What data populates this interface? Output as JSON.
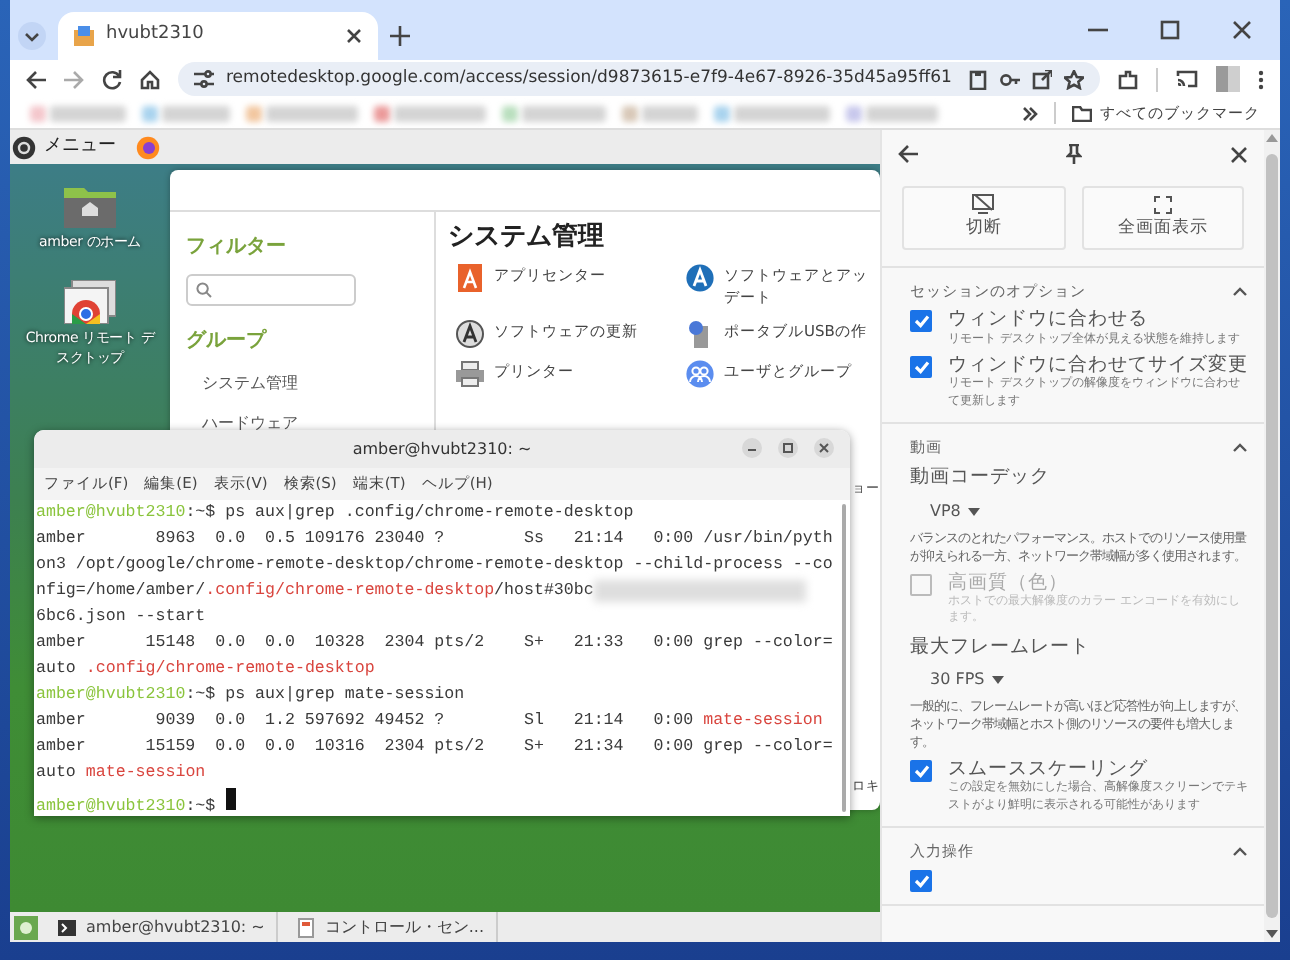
{
  "browser": {
    "tab": {
      "title": "hvubt2310",
      "selected": true
    },
    "address": "remotedesktop.google.com/access/session/d9873615-e7f9-4e67-8926-35d45a95ff61",
    "bookmarks_folder": "すべてのブックマーク"
  },
  "remote_desktop": {
    "top_panel": {
      "menu": "メニュー"
    },
    "desktop_icons": [
      {
        "kind": "folder",
        "label": "amber のホーム"
      },
      {
        "kind": "app",
        "label": "Chrome リモート デ",
        "label_2": "スクトップ"
      }
    ],
    "control_center": {
      "filter_heading": "フィルター",
      "groups_heading": "グループ",
      "groups": [
        "システム管理",
        "ハードウェア"
      ],
      "section_title": "システム管理",
      "items": [
        {
          "kind": "appcenter",
          "lines": [
            "アプリセンター"
          ]
        },
        {
          "kind": "software",
          "lines": [
            "ソフトウェアとアッ",
            "デート"
          ]
        },
        {
          "kind": "update",
          "lines": [
            "ソフトウェアの更新"
          ]
        },
        {
          "kind": "usb",
          "lines": [
            "ポータブルUSBの作"
          ]
        },
        {
          "kind": "printer",
          "lines": [
            "プリンター"
          ]
        },
        {
          "kind": "users",
          "lines": [
            "ユーザとグループ"
          ]
        }
      ],
      "edge_fragments": [
        "ョー",
        "ロキ"
      ]
    },
    "terminal": {
      "title": "amber@hvubt2310: ~",
      "menu": [
        "ファイル(F)",
        "編集(E)",
        "表示(V)",
        "検索(S)",
        "端末(T)",
        "ヘルプ(H)"
      ],
      "lines": [
        [
          {
            "kind": "prompt",
            "text": "amber@hvubt2310"
          },
          {
            "kind": "path",
            "text": ":~$ "
          },
          {
            "kind": "text",
            "text": "ps aux|grep .config/chrome-remote-desktop"
          }
        ],
        [
          {
            "kind": "text",
            "text": "amber       8963  0.0  0.5 109176 23040 ?        Ss   21:14   0:00 /usr/bin/pyth"
          }
        ],
        [
          {
            "kind": "text",
            "text": "on3 /opt/google/chrome-remote-desktop/chrome-remote-desktop --child-process --co"
          }
        ],
        [
          {
            "kind": "text",
            "text": "nfig=/home/amber/"
          },
          {
            "kind": "match",
            "text": ".config/chrome-remote-desktop"
          },
          {
            "kind": "text",
            "text": "/host#30bc"
          },
          {
            "kind": "redacted"
          }
        ],
        [
          {
            "kind": "text",
            "text": "6bc6.json --start"
          }
        ],
        [
          {
            "kind": "text",
            "text": "amber      15148  0.0  0.0  10328  2304 pts/2    S+   21:33   0:00 grep --color="
          }
        ],
        [
          {
            "kind": "text",
            "text": "auto "
          },
          {
            "kind": "match",
            "text": ".config/chrome-remote-desktop"
          }
        ],
        [
          {
            "kind": "prompt",
            "text": "amber@hvubt2310"
          },
          {
            "kind": "path",
            "text": ":~$ "
          },
          {
            "kind": "text",
            "text": "ps aux|grep mate-session"
          }
        ],
        [
          {
            "kind": "text",
            "text": "amber       9039  0.0  1.2 597692 49452 ?        Sl   21:14   0:00 "
          },
          {
            "kind": "match",
            "text": "mate-session"
          }
        ],
        [
          {
            "kind": "text",
            "text": "amber      15159  0.0  0.0  10316  2304 pts/2    S+   21:34   0:00 grep --color="
          }
        ],
        [
          {
            "kind": "text",
            "text": "auto "
          },
          {
            "kind": "match",
            "text": "mate-session"
          }
        ],
        [
          {
            "kind": "prompt",
            "text": "amber@hvubt2310"
          },
          {
            "kind": "path",
            "text": ":~$ "
          },
          {
            "kind": "cursor"
          }
        ]
      ]
    },
    "taskbar": [
      {
        "kind": "terminal",
        "label": "amber@hvubt2310: ~"
      },
      {
        "kind": "control",
        "label": "コントロール・セン..."
      }
    ]
  },
  "side_panel": {
    "buttons": [
      {
        "kind": "disconnect",
        "label": "切断"
      },
      {
        "kind": "fullscreen",
        "label": "全画面表示"
      }
    ],
    "sections": [
      {
        "title": "セッションのオプション",
        "expanded": true,
        "items": [
          {
            "kind": "checkbox",
            "label": "ウィンドウに合わせる",
            "description": "リモート デスクトップ全体が見える状態を維持します",
            "checked": true,
            "disabled": false
          },
          {
            "kind": "checkbox",
            "label": "ウィンドウに合わせてサイズ変更",
            "description": "リモート デスクトップの解像度をウィンドウに合わせて更新します",
            "checked": true,
            "disabled": false
          }
        ]
      },
      {
        "title": "動画",
        "expanded": true,
        "items": [
          {
            "kind": "label",
            "label": "動画コーデック"
          },
          {
            "kind": "select",
            "value": "VP8"
          },
          {
            "kind": "text",
            "label": "バランスのとれたパフォーマンス。ホストでのリソース使用量が抑えられる一方、ネットワーク帯域幅が多く使用されます。"
          },
          {
            "kind": "checkbox",
            "label": "高画質（色）",
            "description": "ホストでの最大解像度のカラー エンコードを有効にします。",
            "checked": false,
            "disabled": true
          },
          {
            "kind": "label",
            "label": "最大フレームレート"
          },
          {
            "kind": "select",
            "value": "30 FPS"
          },
          {
            "kind": "text",
            "label": "一般的に、フレームレートが高いほど応答性が向上しますが、ネットワーク帯域幅とホスト側のリソースの要件も増大します。"
          },
          {
            "kind": "checkbox",
            "label": "スムーススケーリング",
            "description": "この設定を無効にした場合、高解像度スクリーンでテキストがより鮮明に表示される可能性があります",
            "checked": true,
            "disabled": false
          }
        ]
      },
      {
        "title": "入力操作",
        "expanded": true,
        "items": [
          {
            "kind": "checkbox",
            "checked": true,
            "disabled": false
          }
        ]
      }
    ]
  }
}
